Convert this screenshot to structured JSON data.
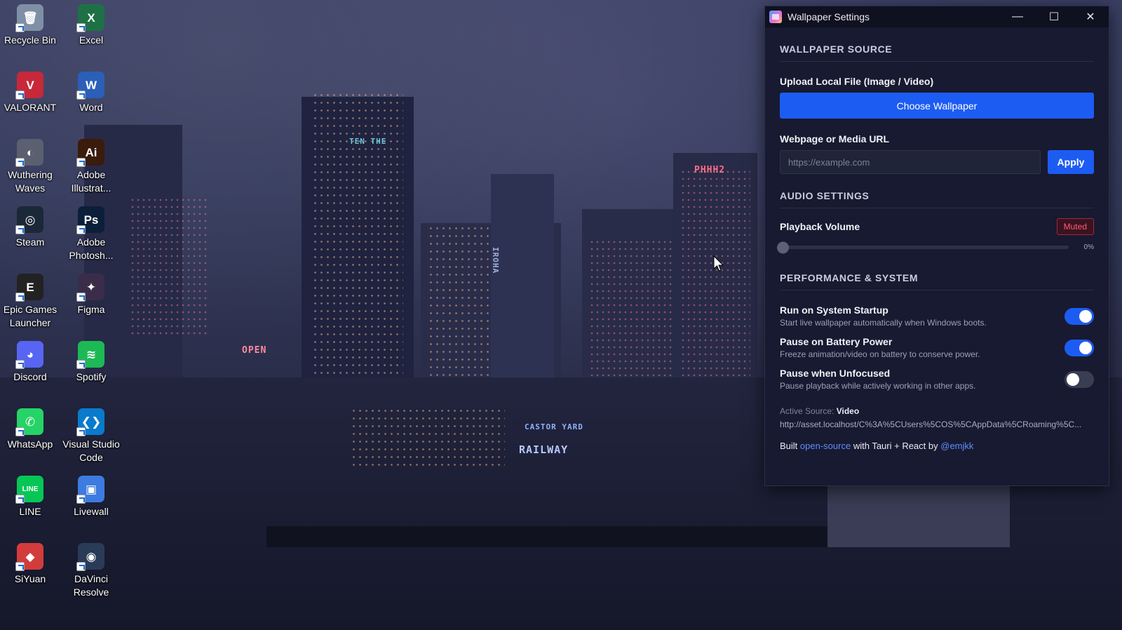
{
  "wallpaper": {
    "signs": [
      "TEN THE",
      "PHHH2",
      "OPEN",
      "CASTOR YARD",
      "RAILWAY",
      "IROHA"
    ]
  },
  "desktop": {
    "icons": [
      {
        "label": "Recycle Bin",
        "icon": "recycle-bin-icon",
        "glyph": "🗑",
        "color": "#7f8fa6"
      },
      {
        "label": "Excel",
        "icon": "excel-icon",
        "glyph": "X",
        "color": "#1e7145"
      },
      {
        "label": "VALORANT",
        "icon": "valorant-icon",
        "glyph": "V",
        "color": "#c7283a"
      },
      {
        "label": "Word",
        "icon": "word-icon",
        "glyph": "W",
        "color": "#2b5fb8"
      },
      {
        "label": "Wuthering Waves",
        "icon": "wuthering-waves-icon",
        "glyph": "◐",
        "color": "#5b6070"
      },
      {
        "label": "Adobe Illustrat...",
        "icon": "adobe-illustrator-icon",
        "glyph": "Ai",
        "color": "#3a1b0c"
      },
      {
        "label": "Steam",
        "icon": "steam-icon",
        "glyph": "◎",
        "color": "#1b2838"
      },
      {
        "label": "Adobe Photosh...",
        "icon": "adobe-photoshop-icon",
        "glyph": "Ps",
        "color": "#0b1f3a"
      },
      {
        "label": "Epic Games Launcher",
        "icon": "epic-games-icon",
        "glyph": "E",
        "color": "#222222"
      },
      {
        "label": "Figma",
        "icon": "figma-icon",
        "glyph": "✦",
        "color": "#3b2d4a"
      },
      {
        "label": "Discord",
        "icon": "discord-icon",
        "glyph": "◕",
        "color": "#5865f2"
      },
      {
        "label": "Spotify",
        "icon": "spotify-icon",
        "glyph": "≋",
        "color": "#1db954"
      },
      {
        "label": "WhatsApp",
        "icon": "whatsapp-icon",
        "glyph": "✆",
        "color": "#25d366"
      },
      {
        "label": "Visual Studio Code",
        "icon": "vscode-icon",
        "glyph": "❮❯",
        "color": "#0a7acc"
      },
      {
        "label": "LINE",
        "icon": "line-icon",
        "glyph": "LINE",
        "color": "#06c755"
      },
      {
        "label": "Livewall",
        "icon": "livewall-icon",
        "glyph": "▣",
        "color": "#3d7be0"
      },
      {
        "label": "SiYuan",
        "icon": "siyuan-icon",
        "glyph": "◆",
        "color": "#d23c3c"
      },
      {
        "label": "DaVinci Resolve",
        "icon": "davinci-resolve-icon",
        "glyph": "◉",
        "color": "#2a3b58"
      }
    ]
  },
  "window": {
    "title": "Wallpaper Settings",
    "controls": {
      "minimize": "—",
      "maximize": "☐",
      "close": "✕"
    },
    "source": {
      "heading": "WALLPAPER SOURCE",
      "upload_label": "Upload Local File (Image / Video)",
      "choose_button": "Choose Wallpaper",
      "url_label": "Webpage or Media URL",
      "url_value": "",
      "url_placeholder": "https://example.com",
      "apply_button": "Apply"
    },
    "audio": {
      "heading": "AUDIO SETTINGS",
      "volume_label": "Playback Volume",
      "muted_badge": "Muted",
      "volume_percent": 0,
      "volume_text": "0%"
    },
    "performance": {
      "heading": "PERFORMANCE & SYSTEM",
      "toggles": [
        {
          "title": "Run on System Startup",
          "desc": "Start live wallpaper automatically when Windows boots.",
          "on": true
        },
        {
          "title": "Pause on Battery Power",
          "desc": "Freeze animation/video on battery to conserve power.",
          "on": true
        },
        {
          "title": "Pause when Unfocused",
          "desc": "Pause playback while actively working in other apps.",
          "on": false
        }
      ]
    },
    "footer": {
      "active_source_key": "Active Source:",
      "active_source_value": "Video",
      "source_url": "http://asset.localhost/C%3A%5CUsers%5COS%5CAppData%5CRoaming%5C...",
      "built_prefix": "Built",
      "open_source": "open-source",
      "built_middle": "with Tauri + React by",
      "author": "@emjkk"
    }
  },
  "colors": {
    "accent": "#1d5cf2",
    "window_bg": "#171a30",
    "muted": "#ff5a74"
  }
}
